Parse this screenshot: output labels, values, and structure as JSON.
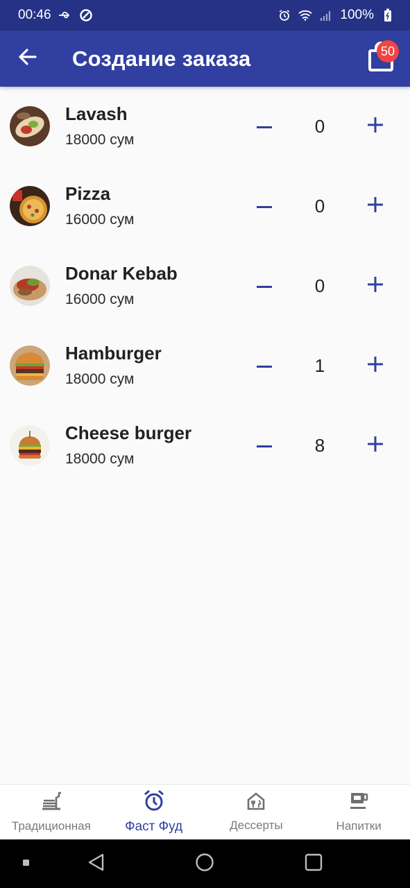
{
  "status_bar": {
    "time": "00:46",
    "battery": "100%"
  },
  "app_bar": {
    "title": "Создание заказа",
    "cart_badge": "50"
  },
  "products": [
    {
      "name": "Lavash",
      "price": "18000 сум",
      "quantity": "0"
    },
    {
      "name": "Pizza",
      "price": "16000 сум",
      "quantity": "0"
    },
    {
      "name": "Donar Kebab",
      "price": "16000 сум",
      "quantity": "0"
    },
    {
      "name": "Hamburger",
      "price": "18000 сум",
      "quantity": "1"
    },
    {
      "name": "Cheese burger",
      "price": "18000 сум",
      "quantity": "8"
    }
  ],
  "bottom_nav": {
    "tabs": [
      {
        "label": "Традиционная",
        "icon": "food-tray-icon"
      },
      {
        "label": "Фаст Фуд",
        "icon": "alarm-clock-icon"
      },
      {
        "label": "Дессерты",
        "icon": "restaurant-icon"
      },
      {
        "label": "Напитки",
        "icon": "coffee-cup-icon"
      }
    ],
    "active_index": 1
  },
  "colors": {
    "status_bar": "#263285",
    "app_bar": "#303fa0",
    "accent": "#303fa0",
    "badge": "#f44343"
  }
}
